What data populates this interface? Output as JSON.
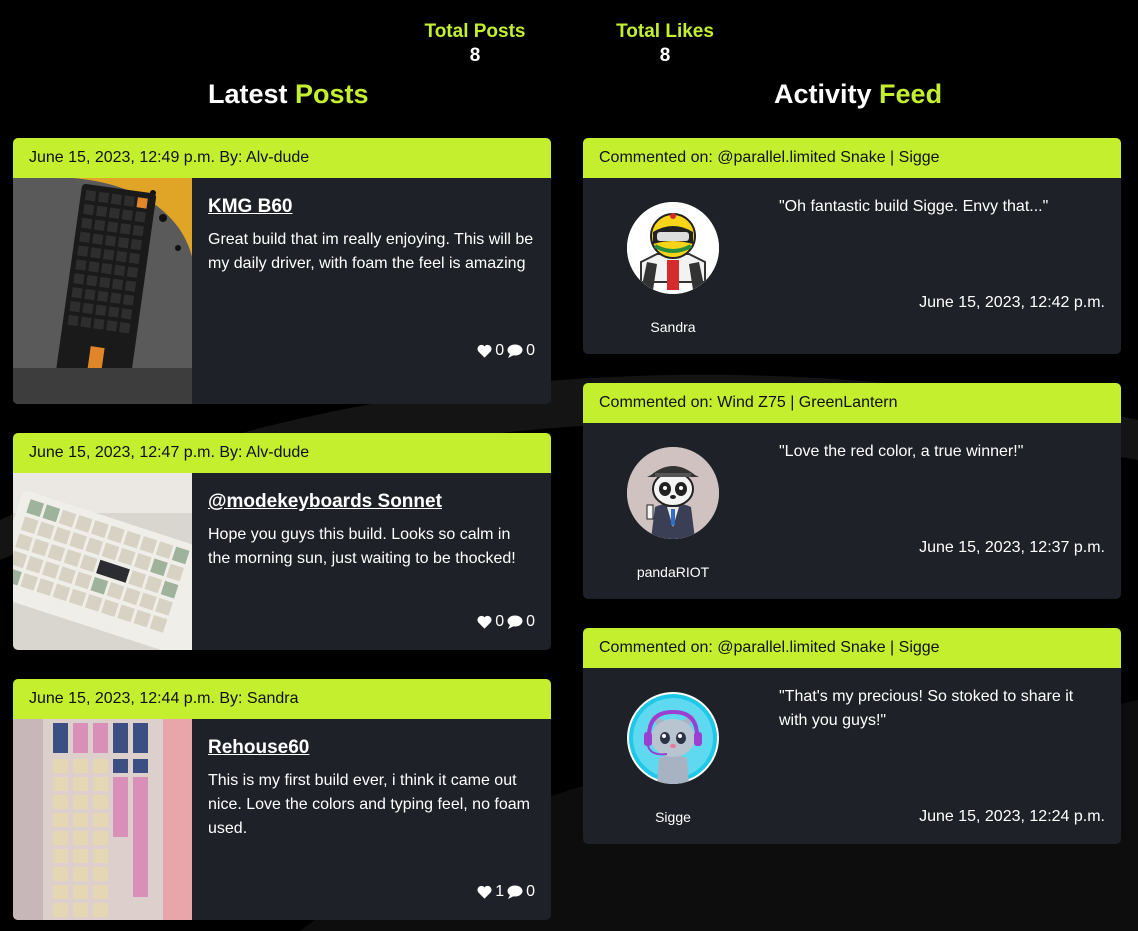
{
  "stats": {
    "posts_label": "Total Posts",
    "posts_value": "8",
    "likes_label": "Total Likes",
    "likes_value": "8"
  },
  "latest": {
    "title_part1": "Latest ",
    "title_part2": "Posts"
  },
  "activity": {
    "title_part1": "Activity ",
    "title_part2": "Feed"
  },
  "posts": [
    {
      "header": "June 15, 2023, 12:49 p.m. By: Alv-dude",
      "title": "KMG B60",
      "text": "Great build that im really enjoying. This will be my daily driver, with foam the feel is amazing",
      "likes": "0",
      "comments": "0"
    },
    {
      "header": "June 15, 2023, 12:47 p.m. By: Alv-dude",
      "title": "@modekeyboards Sonnet",
      "text": "Hope you guys this build. Looks so calm in the morning sun, just waiting to be thocked!",
      "likes": "0",
      "comments": "0"
    },
    {
      "header": "June 15, 2023, 12:44 p.m. By: Sandra",
      "title": "Rehouse60",
      "text": "This is my first build ever, i think it came out nice. Love the colors and typing feel, no foam used.",
      "likes": "1",
      "comments": "0"
    }
  ],
  "feed": [
    {
      "header": "Commented on: @parallel.limited Snake | Sigge",
      "user": "Sandra",
      "quote": "\"Oh fantastic build Sigge. Envy that...\"",
      "time": "June 15, 2023, 12:42 p.m."
    },
    {
      "header": "Commented on: Wind Z75 | GreenLantern",
      "user": "pandaRIOT",
      "quote": "\"Love the red color, a true winner!\"",
      "time": "June 15, 2023, 12:37 p.m."
    },
    {
      "header": "Commented on: @parallel.limited Snake | Sigge",
      "user": "Sigge",
      "quote": "\"That's my precious! So stoked to share it with you guys!\"",
      "time": "June 15, 2023, 12:24 p.m."
    }
  ],
  "colors": {
    "accent": "#c3ef2e",
    "card": "#1e2127",
    "background": "#000000"
  }
}
